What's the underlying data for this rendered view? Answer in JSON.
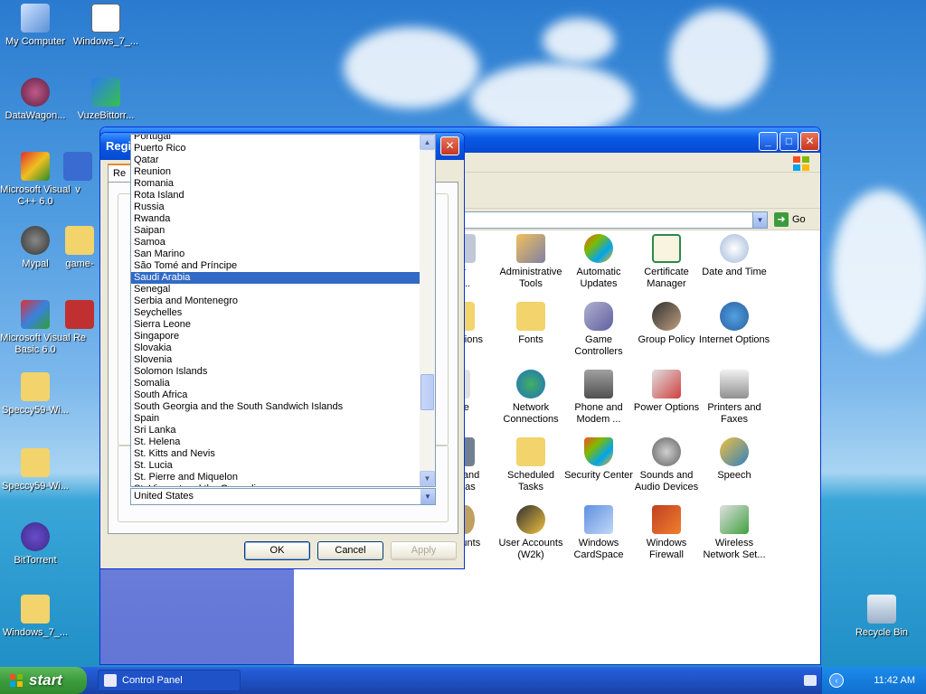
{
  "desktop": {
    "icons": [
      {
        "label": "My Computer"
      },
      {
        "label": "Windows_7_..."
      },
      {
        "label": "DataWagon..."
      },
      {
        "label": "VuzeBittorr..."
      },
      {
        "label": "Microsoft Visual C++ 6.0"
      },
      {
        "label": "v"
      },
      {
        "label": "Mypal"
      },
      {
        "label": "game-"
      },
      {
        "label": "Microsoft Visual Basic 6.0"
      },
      {
        "label": "Re"
      },
      {
        "label": "Speccy59-Wi..."
      },
      {
        "label": "Speccy59-Wi..."
      },
      {
        "label": "BitTorrent"
      },
      {
        "label": "Windows_7_..."
      },
      {
        "label": "Recycle Bin"
      }
    ]
  },
  "control_panel": {
    "go_label": "Go",
    "items": [
      {
        "label": "or\nov..."
      },
      {
        "label": "Administrative Tools"
      },
      {
        "label": "Automatic Updates"
      },
      {
        "label": "Certificate Manager"
      },
      {
        "label": "Date and Time"
      },
      {
        "label": "Options"
      },
      {
        "label": "Fonts"
      },
      {
        "label": "Game Controllers"
      },
      {
        "label": "Group Policy"
      },
      {
        "label": "Internet Options"
      },
      {
        "label": "use"
      },
      {
        "label": "Network Connections"
      },
      {
        "label": "Phone and Modem ..."
      },
      {
        "label": "Power Options"
      },
      {
        "label": "Printers and Faxes"
      },
      {
        "label": "rs and\neras"
      },
      {
        "label": "Scheduled Tasks"
      },
      {
        "label": "Security Center"
      },
      {
        "label": "Sounds and Audio Devices"
      },
      {
        "label": "Speech"
      },
      {
        "label": "counts"
      },
      {
        "label": "User Accounts (W2k)"
      },
      {
        "label": "Windows CardSpace"
      },
      {
        "label": "Windows Firewall"
      },
      {
        "label": "Wireless Network Set..."
      }
    ]
  },
  "dialog": {
    "title": "Regi",
    "tab_label": "Re",
    "ok_label": "OK",
    "cancel_label": "Cancel",
    "apply_label": "Apply"
  },
  "dropdown": {
    "items": [
      "Portugal",
      "Puerto Rico",
      "Qatar",
      "Reunion",
      "Romania",
      "Rota Island",
      "Russia",
      "Rwanda",
      "Saipan",
      "Samoa",
      "San Marino",
      "São Tomé and Príncipe",
      "Saudi Arabia",
      "Senegal",
      "Serbia and Montenegro",
      "Seychelles",
      "Sierra Leone",
      "Singapore",
      "Slovakia",
      "Slovenia",
      "Solomon Islands",
      "Somalia",
      "South Africa",
      "South Georgia and the South Sandwich Islands",
      "Spain",
      "Sri Lanka",
      "St. Helena",
      "St. Kitts and Nevis",
      "St. Lucia",
      "St. Pierre and Miquelon",
      "St. Vincent and the Grenadines"
    ],
    "selected": "Saudi Arabia",
    "combo_value": "United States"
  },
  "taskbar": {
    "start_label": "start",
    "task_label": "Control Panel",
    "clock": "11:42 AM"
  }
}
